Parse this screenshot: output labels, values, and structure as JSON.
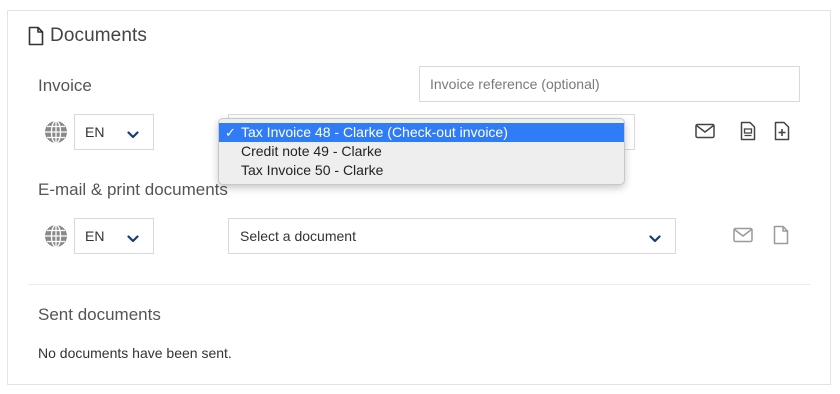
{
  "header": {
    "title": "Documents",
    "icon": "file-icon"
  },
  "invoice": {
    "label": "Invoice",
    "reference_placeholder": "Invoice reference (optional)",
    "reference_value": "",
    "language": "EN",
    "dropdown": {
      "options": [
        "Tax Invoice 48 - Clarke (Check-out invoice)",
        "Credit note 49 - Clarke",
        "Tax Invoice 50 - Clarke"
      ],
      "selected_index": 0,
      "check_mark": "✓",
      "highlight_color": "#2f7cf6"
    },
    "actions": [
      "envelope-icon",
      "print-document-icon",
      "add-document-icon"
    ]
  },
  "email_print": {
    "label": "E-mail & print documents",
    "language": "EN",
    "select_value": "Select a document",
    "actions": [
      "envelope-icon",
      "file-icon"
    ]
  },
  "sent": {
    "label": "Sent documents",
    "message": "No documents have been sent."
  },
  "colors": {
    "border": "#d9d9d9",
    "icon": "#444444",
    "icon_disabled": "#9a9a9a",
    "globe": "#8a8a8a",
    "chevron": "#1a3d6e"
  }
}
